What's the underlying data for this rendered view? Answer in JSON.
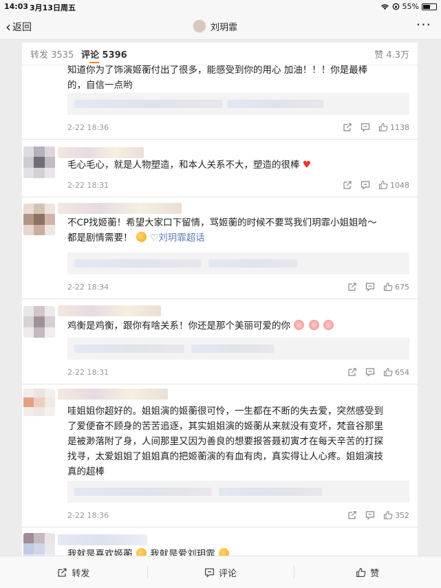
{
  "status": {
    "time": "14:03",
    "date": "3月13日周五",
    "battery": "55%",
    "battery_level": 0.55
  },
  "nav": {
    "back_label": "返回",
    "title": "刘玥霏",
    "more": "···"
  },
  "tabs": {
    "forward": "转发 3535",
    "comments": "评论 5396",
    "likes": "赞 4.3万"
  },
  "comments": [
    {
      "lines": [
        "知道你为了饰演姬蘅付出了很多，能感受到你的用心 加油！！！你是最棒",
        "的，自信一点哟"
      ],
      "time": "2-22 18:36",
      "likes": "1138"
    },
    {
      "text_before": "毛心毛心，就是人物塑造，和本人关系不大，塑造的很棒",
      "time": "2-22 18:31",
      "likes": "1048"
    },
    {
      "line1": "不CP找姬蘅！希望大家口下留情，骂姬蘅的时候不要骂我们玥霏小姐姐哈～",
      "line2_before": "都是剧情需要！",
      "link": "♡刘玥霏超话",
      "time": "2-22 18:34",
      "likes": "675"
    },
    {
      "text": "鸡衡是鸡衡，跟你有啥关系！你还是那个美丽可爱的你",
      "time": "2-22 18:31",
      "likes": "654"
    },
    {
      "lines": [
        "哇姐姐你超好的。姐姐演的姬蘅很可怜，一生都在不断的失去爱，突然感受到",
        "了爱便奋不顾身的苦苦追逐，其实姐姐演的姬蘅从来就没有变坏，梵音谷那里",
        "是被渺落附了身，人间那里又因为善良的想要报答聂初寅才在每天辛苦的打探",
        "找寻，太爱姐姐了姐姐真的把姬蘅演的有血有肉，真实得让人心疼。姐姐演技",
        "真的超棒"
      ],
      "time": "2-22 18:36",
      "likes": "352"
    },
    {
      "part1": "我就是喜欢姬蘅",
      "part2": "我就是爱刘玥霏"
    }
  ],
  "bottom": {
    "forward": "转发",
    "comment": "评论",
    "like": "赞"
  },
  "colors": {
    "accent": "#ff8200",
    "link": "#5b7db5"
  }
}
